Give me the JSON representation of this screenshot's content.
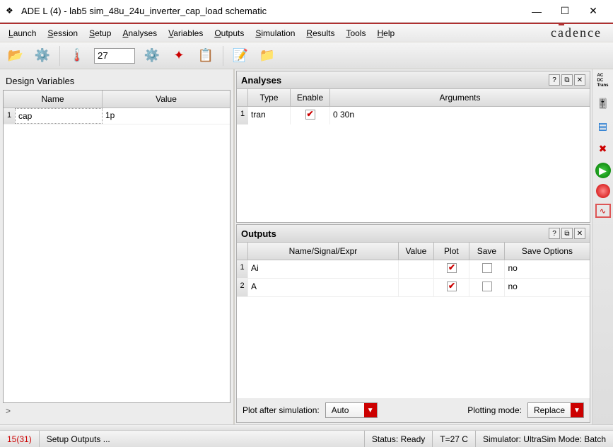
{
  "title": "ADE L (4) - lab5 sim_48u_24u_inverter_cap_load schematic",
  "menus": {
    "launch": "Launch",
    "session": "Session",
    "setup": "Setup",
    "analyses": "Analyses",
    "variables": "Variables",
    "outputs": "Outputs",
    "simulation": "Simulation",
    "results": "Results",
    "tools": "Tools",
    "help": "Help"
  },
  "brand": "cadence",
  "toolbar": {
    "temp_value": "27"
  },
  "design_vars": {
    "title": "Design Variables",
    "columns": {
      "name": "Name",
      "value": "Value"
    },
    "rows": [
      {
        "idx": "1",
        "name": "cap",
        "value": "1p"
      }
    ],
    "prompt": ">"
  },
  "analyses": {
    "title": "Analyses",
    "columns": {
      "type": "Type",
      "enable": "Enable",
      "arguments": "Arguments"
    },
    "rows": [
      {
        "idx": "1",
        "type": "tran",
        "enabled": true,
        "arguments": "0 30n"
      }
    ]
  },
  "outputs": {
    "title": "Outputs",
    "columns": {
      "name": "Name/Signal/Expr",
      "value": "Value",
      "plot": "Plot",
      "save": "Save",
      "saveopts": "Save Options"
    },
    "rows": [
      {
        "idx": "1",
        "name": "Ai",
        "value": "",
        "plot": true,
        "save": false,
        "saveopts": "no"
      },
      {
        "idx": "2",
        "name": "A",
        "value": "",
        "plot": true,
        "save": false,
        "saveopts": "no"
      }
    ],
    "plot_after_label": "Plot after simulation:",
    "plot_after_value": "Auto",
    "plot_mode_label": "Plotting mode:",
    "plot_mode_value": "Replace"
  },
  "sidebar": {
    "analysis_modes": "AC\nDC\nTrans"
  },
  "status": {
    "mouse": "15(31)",
    "hint": "Setup Outputs ...",
    "status": "Status: Ready",
    "temp": "T=27 C",
    "sim": "Simulator: UltraSim Mode: Batch"
  }
}
